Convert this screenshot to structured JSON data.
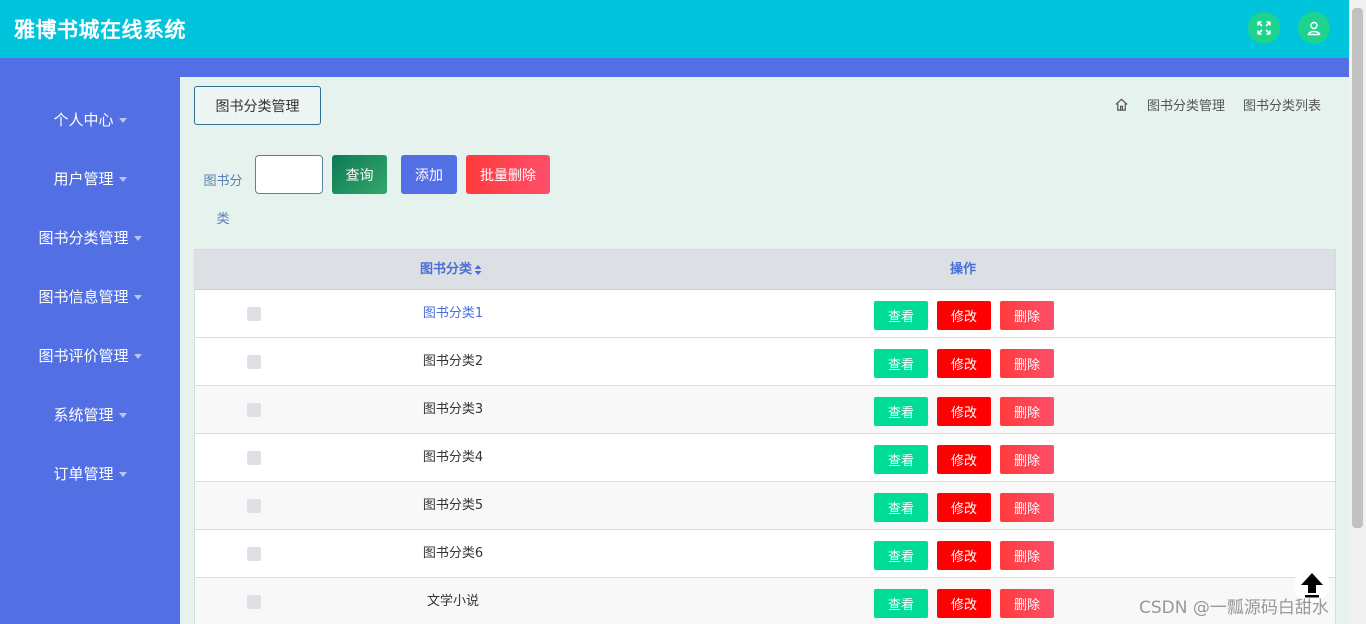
{
  "header": {
    "title": "雅博书城在线系统",
    "icons": [
      "fullscreen-icon",
      "user-icon"
    ],
    "color": "#00c3dc"
  },
  "sidebar": {
    "color": "#526fe3",
    "items": [
      {
        "label": "个人中心"
      },
      {
        "label": "用户管理"
      },
      {
        "label": "图书分类管理"
      },
      {
        "label": "图书信息管理"
      },
      {
        "label": "图书评价管理"
      },
      {
        "label": "系统管理"
      },
      {
        "label": "订单管理"
      }
    ]
  },
  "page": {
    "tag": "图书分类管理",
    "breadcrumb": [
      "图书分类管理",
      "图书分类列表"
    ]
  },
  "filter": {
    "label": "图书分类",
    "input_value": "",
    "search_label": "查询",
    "add_label": "添加",
    "batch_delete_label": "批量删除"
  },
  "table": {
    "headers": {
      "name": "图书分类",
      "actions": "操作"
    },
    "rows": [
      {
        "name": "图书分类1"
      },
      {
        "name": "图书分类2"
      },
      {
        "name": "图书分类3"
      },
      {
        "name": "图书分类4"
      },
      {
        "name": "图书分类5"
      },
      {
        "name": "图书分类6"
      },
      {
        "name": "文学小说"
      }
    ],
    "actions": {
      "view": "查看",
      "edit": "修改",
      "delete": "删除"
    }
  },
  "watermark": "CSDN @一瓢源码白甜水"
}
